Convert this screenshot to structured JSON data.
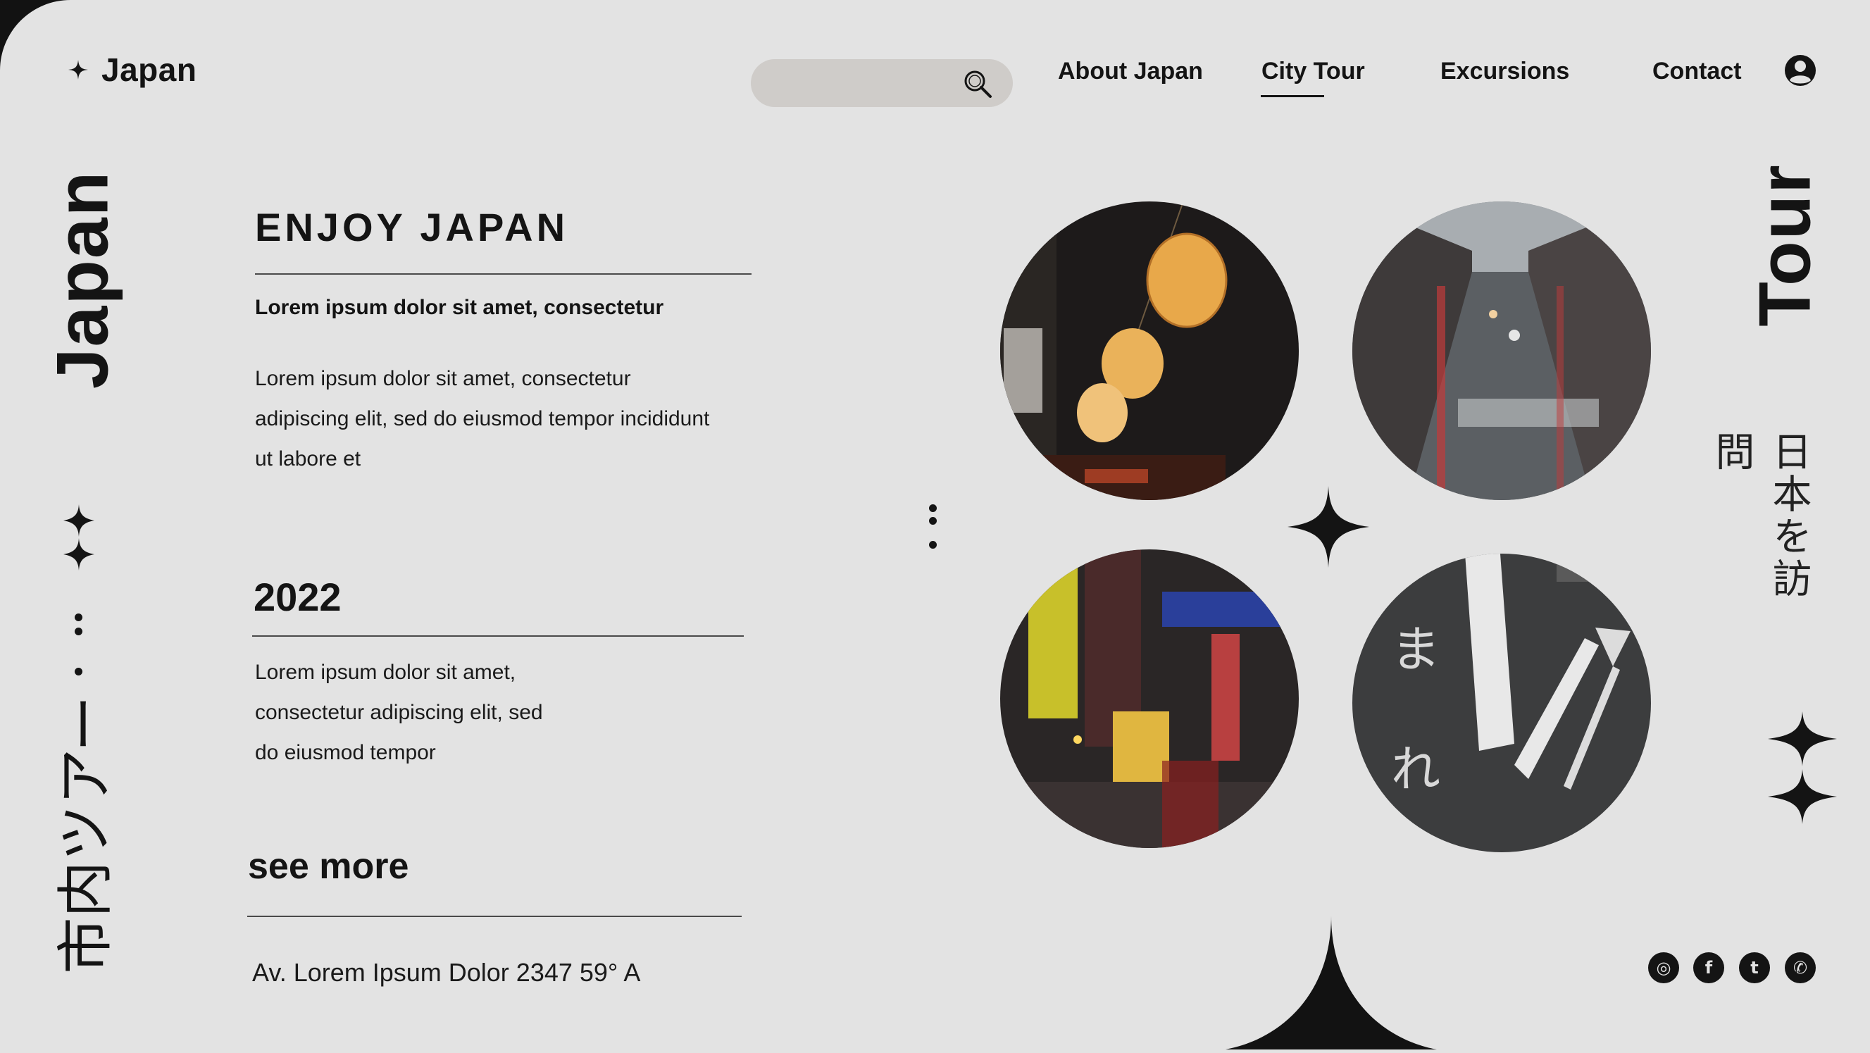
{
  "brand": {
    "name": "Japan"
  },
  "search": {
    "value": "",
    "placeholder": ""
  },
  "nav": {
    "items": [
      {
        "label": "About Japan"
      },
      {
        "label": "City Tour",
        "active": true
      },
      {
        "label": "Excursions"
      },
      {
        "label": "Contact"
      }
    ]
  },
  "side": {
    "left_title": "Japan",
    "right_title": "Tour",
    "left_japanese": "市内ツアー",
    "right_japanese": "日本を訪問"
  },
  "main": {
    "heading": "ENJOY JAPAN",
    "subheading": "Lorem ipsum dolor sit amet, consectetur",
    "para1_lines": [
      "Lorem ipsum dolor sit amet, consectetur",
      "adipiscing elit, sed do eiusmod tempor incididunt",
      "ut labore et"
    ],
    "year": "2022",
    "para2_lines": [
      "Lorem ipsum dolor sit amet,",
      "consectetur adipiscing elit, sed",
      "do eiusmod tempor"
    ],
    "see_more": "see more",
    "address": "Av. Lorem Ipsum Dolor 2347 59° A"
  },
  "photos": [
    {
      "name": "lanterns-photo",
      "subject": "night lanterns"
    },
    {
      "name": "rainy-street-photo",
      "subject": "rainy city street from above"
    },
    {
      "name": "shibuya-street-photo",
      "subject": "neon shopping street at night"
    },
    {
      "name": "road-markings-photo",
      "subject": "road markings with arrows"
    }
  ],
  "social": [
    {
      "icon": "instagram-icon",
      "glyph": "◎"
    },
    {
      "icon": "facebook-icon",
      "glyph": "f"
    },
    {
      "icon": "twitter-icon",
      "glyph": "t"
    },
    {
      "icon": "whatsapp-icon",
      "glyph": "✆"
    }
  ],
  "colors": {
    "background": "#e3e3e3",
    "ink": "#141414",
    "search_bg": "#cfccc9"
  }
}
